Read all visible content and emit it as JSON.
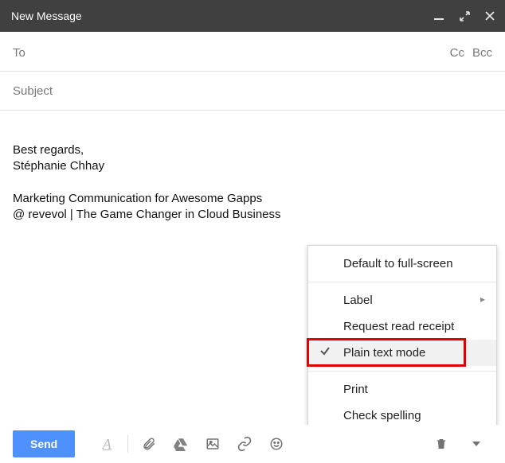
{
  "header": {
    "title": "New Message"
  },
  "fields": {
    "to_label": "To",
    "cc_label": "Cc",
    "bcc_label": "Bcc",
    "subject_label": "Subject"
  },
  "body": {
    "line1": "Best regards,",
    "line2": "Stéphanie Chhay",
    "line3": "Marketing Communication for Awesome Gapps",
    "line4": "@ revevol | The Game Changer in Cloud Business"
  },
  "toolbar": {
    "send_label": "Send"
  },
  "menu": {
    "fullscreen": "Default to full-screen",
    "label": "Label",
    "read_receipt": "Request read receipt",
    "plaintext": "Plain text mode",
    "print": "Print",
    "spelling": "Check spelling"
  }
}
